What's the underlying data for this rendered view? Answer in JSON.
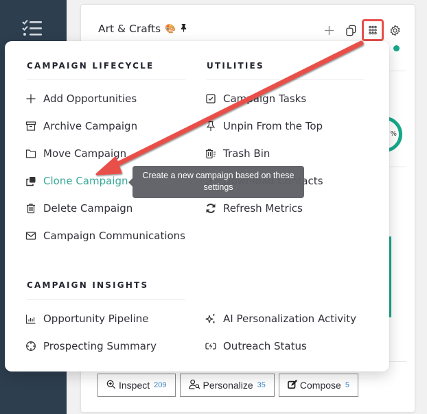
{
  "sidebar": {
    "icon": "checklist-icon"
  },
  "card": {
    "title": "Art & Crafts",
    "title_emoji": "🎨",
    "title_pin_icon": "pin-icon",
    "tools": [
      {
        "name": "add",
        "icon": "plus-icon"
      },
      {
        "name": "copy",
        "icon": "copy-icon"
      },
      {
        "name": "apps",
        "icon": "grid-dots-icon",
        "highlighted": true
      },
      {
        "name": "settings",
        "icon": "gear-icon"
      }
    ],
    "status_color": "#17a88a",
    "ring_label": "%",
    "actions": [
      {
        "label": "Inspect",
        "count": "209",
        "icon": "zoom-in-icon"
      },
      {
        "label": "Personalize",
        "count": "35",
        "icon": "user-search-icon"
      },
      {
        "label": "Compose",
        "count": "5",
        "icon": "edit-icon"
      }
    ]
  },
  "menu": {
    "sections": {
      "lifecycle": {
        "title": "CAMPAIGN LIFECYCLE",
        "items": [
          {
            "label": "Add Opportunities",
            "icon": "plus-icon"
          },
          {
            "label": "Archive Campaign",
            "icon": "archive-icon"
          },
          {
            "label": "Move Campaign",
            "icon": "folder-icon"
          },
          {
            "label": "Clone Campaign",
            "icon": "clone-icon",
            "active": true
          },
          {
            "label": "Delete Campaign",
            "icon": "trash-icon"
          },
          {
            "label": "Campaign Communications",
            "icon": "envelope-icon"
          }
        ]
      },
      "utilities": {
        "title": "UTILITIES",
        "items": [
          {
            "label": "Campaign Tasks",
            "icon": "checkbox-icon"
          },
          {
            "label": "Unpin From the Top",
            "icon": "unpin-icon"
          },
          {
            "label": "Trash Bin",
            "icon": "trash-bin-icon"
          },
          {
            "label": "Download Contacts",
            "icon": "download-icon"
          },
          {
            "label": "Refresh Metrics",
            "icon": "refresh-icon"
          }
        ]
      },
      "insights": {
        "title": "CAMPAIGN INSIGHTS",
        "items": [
          {
            "label": "Opportunity Pipeline",
            "icon": "bar-chart-icon"
          },
          {
            "label": "Prospecting Summary",
            "icon": "crosshair-icon"
          },
          {
            "label": "AI Personalization Activity",
            "icon": "sparkles-icon"
          },
          {
            "label": "Outreach Status",
            "icon": "bolt-badge-icon"
          }
        ]
      }
    },
    "tooltip": "Create a new campaign based on these settings",
    "active_color": "#3aa99a"
  },
  "annotation": {
    "color": "#e8504a"
  }
}
